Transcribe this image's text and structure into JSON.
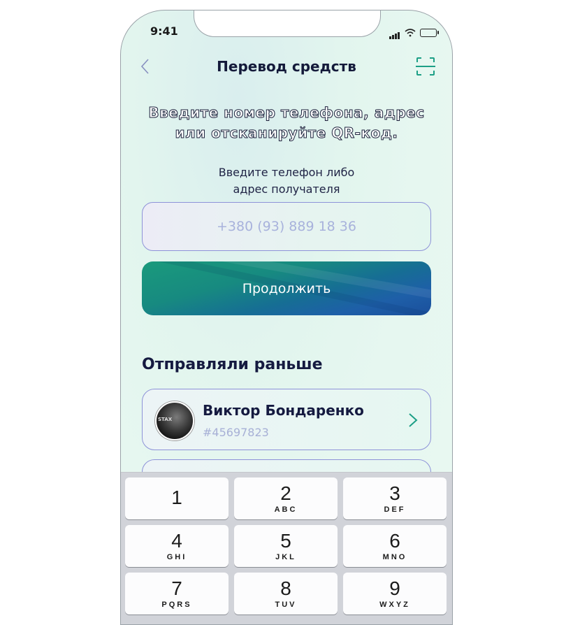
{
  "status_bar": {
    "time": "9:41"
  },
  "header": {
    "title": "Перевод средств"
  },
  "instruction": {
    "heading_line1": "Введите номер телефона, адрес",
    "heading_line2": "или отсканируйте QR-код.",
    "hint_line1": "Введите телефон либо",
    "hint_line2": "адрес получателя"
  },
  "recipient_input": {
    "placeholder": "+380 (93) 889 18 36"
  },
  "continue_button": {
    "label": "Продолжить"
  },
  "recent": {
    "title": "Отправляли раньше",
    "contacts": [
      {
        "name": "Виктор Бондаренко",
        "id": "#45697823",
        "avatar_text": "STAX"
      }
    ]
  },
  "keypad": {
    "keys": [
      {
        "digit": "1",
        "letters": ""
      },
      {
        "digit": "2",
        "letters": "ABC"
      },
      {
        "digit": "3",
        "letters": "DEF"
      },
      {
        "digit": "4",
        "letters": "GHI"
      },
      {
        "digit": "5",
        "letters": "JKL"
      },
      {
        "digit": "6",
        "letters": "MNO"
      },
      {
        "digit": "7",
        "letters": "PQRS"
      },
      {
        "digit": "8",
        "letters": "TUV"
      },
      {
        "digit": "9",
        "letters": "WXYZ"
      }
    ]
  }
}
